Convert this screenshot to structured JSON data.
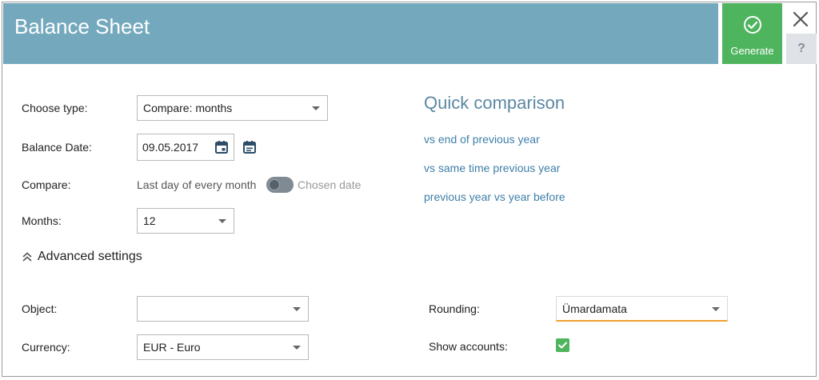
{
  "header": {
    "title": "Balance Sheet"
  },
  "actions": {
    "generate_label": "Generate",
    "help_label": "?"
  },
  "form": {
    "choose_type": {
      "label": "Choose type:",
      "value": "Compare: months"
    },
    "balance_date": {
      "label": "Balance Date:",
      "value": "09.05.2017"
    },
    "compare": {
      "label": "Compare:",
      "option_left": "Last day of every month",
      "option_right": "Chosen date"
    },
    "months": {
      "label": "Months:",
      "value": "12"
    }
  },
  "quick_comparison": {
    "title": "Quick comparison",
    "links": [
      "vs end of previous year",
      "vs same time previous year",
      "previous year vs year before"
    ]
  },
  "advanced": {
    "label": "Advanced settings",
    "object": {
      "label": "Object:",
      "value": ""
    },
    "currency": {
      "label": "Currency:",
      "value": "EUR - Euro"
    },
    "rounding": {
      "label": "Rounding:",
      "value": "Ümardamata"
    },
    "show_accounts": {
      "label": "Show accounts:",
      "checked": true
    }
  },
  "colors": {
    "header_bg": "#74a9bd",
    "generate_bg": "#4fb45e",
    "link": "#3f7fa8",
    "focus_underline": "#f0a030"
  }
}
